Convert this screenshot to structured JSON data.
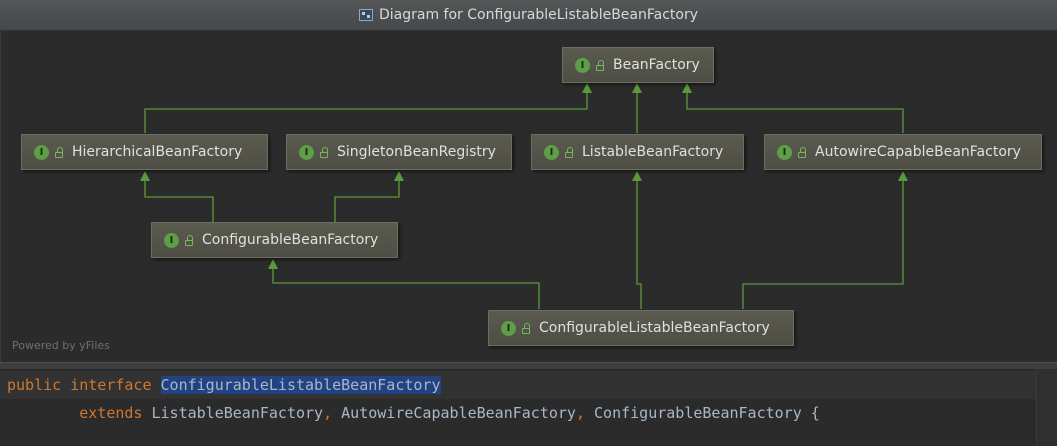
{
  "window": {
    "title": "Diagram for ConfigurableListableBeanFactory"
  },
  "diagram": {
    "interface_badge": "I",
    "nodes": {
      "bean_factory": "BeanFactory",
      "hierarchical_bean_factory": "HierarchicalBeanFactory",
      "singleton_bean_registry": "SingletonBeanRegistry",
      "listable_bean_factory": "ListableBeanFactory",
      "autowire_capable_bean_factory": "AutowireCapableBeanFactory",
      "configurable_bean_factory": "ConfigurableBeanFactory",
      "configurable_listable_bean_factory": "ConfigurableListableBeanFactory"
    },
    "edges": [
      [
        "HierarchicalBeanFactory",
        "BeanFactory"
      ],
      [
        "ListableBeanFactory",
        "BeanFactory"
      ],
      [
        "AutowireCapableBeanFactory",
        "BeanFactory"
      ],
      [
        "ConfigurableBeanFactory",
        "HierarchicalBeanFactory"
      ],
      [
        "ConfigurableBeanFactory",
        "SingletonBeanRegistry"
      ],
      [
        "ConfigurableListableBeanFactory",
        "ConfigurableBeanFactory"
      ],
      [
        "ConfigurableListableBeanFactory",
        "ListableBeanFactory"
      ],
      [
        "ConfigurableListableBeanFactory",
        "AutowireCapableBeanFactory"
      ]
    ],
    "powered_by": "Powered by yFiles",
    "edge_color": "#5a9a3c"
  },
  "editor": {
    "line1": {
      "kw_public": "public",
      "kw_interface": "interface",
      "selected": "ConfigurableListableBeanFactory"
    },
    "line2": {
      "kw_extends": "extends",
      "type1": "ListableBeanFactory",
      "sep1": ",",
      "type2": "AutowireCapableBeanFactory",
      "sep2": ",",
      "type3": "ConfigurableBeanFactory",
      "tail": "{"
    }
  }
}
